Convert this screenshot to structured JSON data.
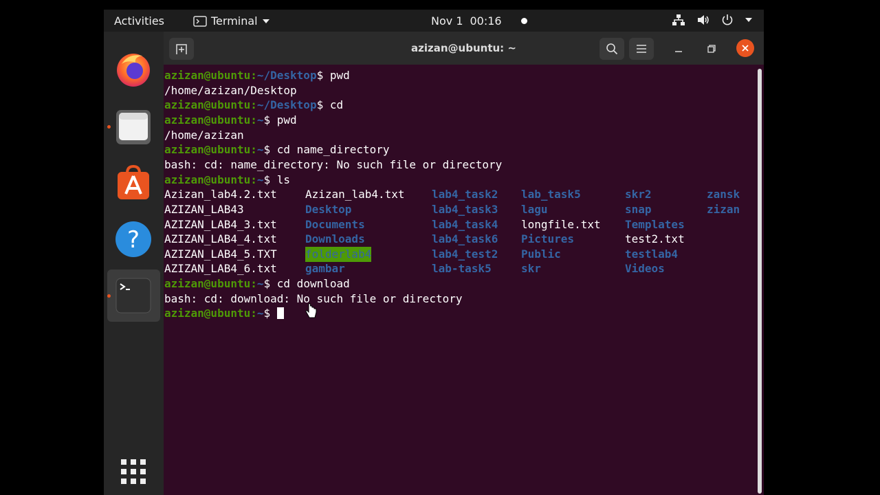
{
  "topbar": {
    "activities": "Activities",
    "app_menu": "Terminal",
    "date": "Nov 1",
    "time": "00:16"
  },
  "dock": {
    "items": [
      "firefox",
      "files",
      "ubuntu-software",
      "help",
      "terminal",
      "show-applications"
    ]
  },
  "window": {
    "title": "azizan@ubuntu: ~"
  },
  "terminal": {
    "lines": [
      {
        "user": "azizan@ubuntu",
        "path": "~/Desktop",
        "cmd": "pwd"
      },
      {
        "text": "/home/azizan/Desktop"
      },
      {
        "user": "azizan@ubuntu",
        "path": "~/Desktop",
        "cmd": "cd"
      },
      {
        "user": "azizan@ubuntu",
        "path": "~",
        "cmd": "pwd"
      },
      {
        "text": "/home/azizan"
      },
      {
        "user": "azizan@ubuntu",
        "path": "~",
        "cmd": "cd name_directory"
      },
      {
        "text": "bash: cd: name_directory: No such file or directory"
      },
      {
        "user": "azizan@ubuntu",
        "path": "~",
        "cmd": "ls"
      },
      {
        "ls": 0
      },
      {
        "ls": 1
      },
      {
        "ls": 2
      },
      {
        "ls": 3
      },
      {
        "ls": 4
      },
      {
        "ls": 5
      },
      {
        "user": "azizan@ubuntu",
        "path": "~",
        "cmd": "cd download"
      },
      {
        "text": "bash: cd: download: No such file or directory"
      },
      {
        "user": "azizan@ubuntu",
        "path": "~",
        "cmd": ""
      }
    ],
    "ls_rows": [
      [
        {
          "name": "Azizan_lab4.2.txt",
          "kind": "file"
        },
        {
          "name": "Azizan_lab4.txt",
          "kind": "file"
        },
        {
          "name": "lab4_task2",
          "kind": "dir"
        },
        {
          "name": "lab_task5",
          "kind": "dir"
        },
        {
          "name": "skr2",
          "kind": "dir"
        },
        {
          "name": "zansk",
          "kind": "dir"
        }
      ],
      [
        {
          "name": "AZIZAN_LAB43",
          "kind": "file"
        },
        {
          "name": "Desktop",
          "kind": "dir"
        },
        {
          "name": "lab4_task3",
          "kind": "dir"
        },
        {
          "name": "lagu",
          "kind": "dir"
        },
        {
          "name": "snap",
          "kind": "dir"
        },
        {
          "name": "zizan",
          "kind": "dir"
        }
      ],
      [
        {
          "name": "AZIZAN_LAB4_3.txt",
          "kind": "file"
        },
        {
          "name": "Documents",
          "kind": "dir"
        },
        {
          "name": "lab4_task4",
          "kind": "dir"
        },
        {
          "name": "longfile.txt",
          "kind": "file"
        },
        {
          "name": "Templates",
          "kind": "dir"
        },
        null
      ],
      [
        {
          "name": "AZIZAN_LAB4_4.txt",
          "kind": "file"
        },
        {
          "name": "Downloads",
          "kind": "dir"
        },
        {
          "name": "lab4_task6",
          "kind": "dir"
        },
        {
          "name": "Pictures",
          "kind": "dir"
        },
        {
          "name": "test2.txt",
          "kind": "file"
        },
        null
      ],
      [
        {
          "name": "AZIZAN_LAB4_5.TXT",
          "kind": "file"
        },
        {
          "name": "folderlab4",
          "kind": "highlight"
        },
        {
          "name": "lab4_test2",
          "kind": "dir"
        },
        {
          "name": "Public",
          "kind": "dir"
        },
        {
          "name": "testlab4",
          "kind": "dir"
        },
        null
      ],
      [
        {
          "name": "AZIZAN_LAB4_6.txt",
          "kind": "file"
        },
        {
          "name": "gambar",
          "kind": "dir"
        },
        {
          "name": "lab-task5",
          "kind": "dir"
        },
        {
          "name": "skr",
          "kind": "dir"
        },
        {
          "name": "Videos",
          "kind": "dir"
        },
        null
      ]
    ]
  },
  "colors": {
    "prompt_user": "#4e9a06",
    "prompt_path": "#3465a4",
    "background": "#300a24",
    "close_button": "#e95420"
  }
}
